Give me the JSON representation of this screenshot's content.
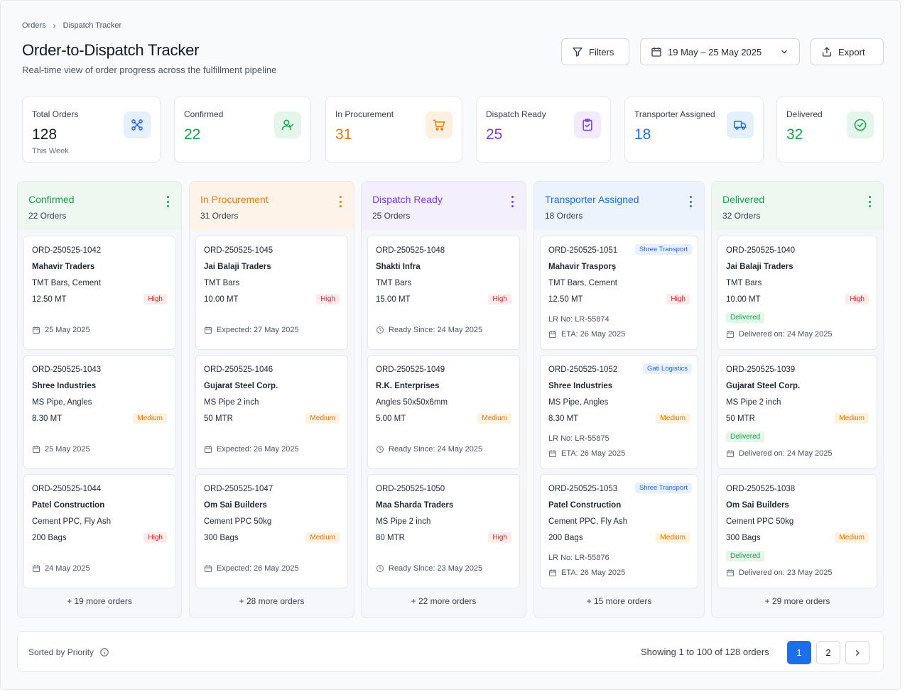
{
  "breadcrumb": {
    "root": "Orders",
    "current": "Dispatch Tracker"
  },
  "header": {
    "title": "Order-to-Dispatch Tracker",
    "subtitle": "Real-time view of order progress across the fulfillment pipeline",
    "filters_label": "Filters",
    "date_range": "19 May – 25 May 2025",
    "export_label": "Export"
  },
  "stats": [
    {
      "label": "Total Orders",
      "value": "128",
      "sub": "This Week",
      "icon": "network-icon",
      "color": "#111827",
      "tint": "#e6effc",
      "iconColor": "#2563eb"
    },
    {
      "label": "Confirmed",
      "value": "22",
      "icon": "user-check-icon",
      "color": "#16a34a",
      "tint": "#e6f5ec",
      "iconColor": "#16a34a"
    },
    {
      "label": "In Procurement",
      "value": "31",
      "icon": "cart-icon",
      "color": "#ea7a12",
      "tint": "#fdf0e1",
      "iconColor": "#ea7a12"
    },
    {
      "label": "Dispatch Ready",
      "value": "25",
      "icon": "clipboard-check-icon",
      "color": "#7c3aed",
      "tint": "#f1ebfd",
      "iconColor": "#7c3aed"
    },
    {
      "label": "Transporter Assigned",
      "value": "18",
      "icon": "truck-icon",
      "color": "#1d6fe8",
      "tint": "#e6effc",
      "iconColor": "#1d6fe8"
    },
    {
      "label": "Delivered",
      "value": "32",
      "icon": "check-circle-icon",
      "color": "#16a34a",
      "tint": "#e6f5ec",
      "iconColor": "#16a34a"
    }
  ],
  "columns": [
    {
      "name": "Confirmed",
      "count": "22 Orders",
      "more": "+ 19 more orders",
      "color": "#16a34a",
      "headerBg": "#eef8f1",
      "footIcon": "calendar-icon",
      "cards": [
        {
          "id": "ORD-250525-1042",
          "customer": "Mahavir Traders",
          "product": "TMT Bars, Cement",
          "qty": "12.50 MT",
          "priority": "High",
          "footer": "25 May 2025"
        },
        {
          "id": "ORD-250525-1043",
          "customer": "Shree Industries",
          "product": "MS Pipe, Angles",
          "qty": "8.30 MT",
          "priority": "Medium",
          "footer": "25 May 2025"
        },
        {
          "id": "ORD-250525-1044",
          "customer": "Patel Construction",
          "product": "Cement PPC, Fly Ash",
          "qty": "200 Bags",
          "priority": "High",
          "footer": "24 May 2025"
        }
      ]
    },
    {
      "name": "In Procurement",
      "count": "31 Orders",
      "more": "+ 28 more orders",
      "color": "#ea7a12",
      "headerBg": "#fdf3e8",
      "footIcon": "calendar-icon",
      "cards": [
        {
          "id": "ORD-250525-1045",
          "customer": "Jai Balaji Traders",
          "product": "TMT Bars",
          "qty": "10.00 MT",
          "priority": "High",
          "footer": "Expected: 27 May 2025"
        },
        {
          "id": "ORD-250525-1046",
          "customer": "Gujarat Steel Corp.",
          "product": "MS Pipe 2 inch",
          "qty": "50 MTR",
          "priority": "Medium",
          "footer": "Expected: 26 May 2025"
        },
        {
          "id": "ORD-250525-1047",
          "customer": "Om Sai Builders",
          "product": "Cement PPC 50kg",
          "qty": "300 Bags",
          "priority": "Medium",
          "footer": "Expected: 26 May 2025"
        }
      ]
    },
    {
      "name": "Dispatch Ready",
      "count": "25 Orders",
      "more": "+ 22 more orders",
      "color": "#7c3aed",
      "headerBg": "#f3effc",
      "footIcon": "clock-icon",
      "cards": [
        {
          "id": "ORD-250525-1048",
          "customer": "Shakti Infra",
          "product": "TMT Bars",
          "qty": "15.00 MT",
          "priority": "High",
          "footer": "Ready Since: 24 May 2025"
        },
        {
          "id": "ORD-250525-1049",
          "customer": "R.K. Enterprises",
          "product": "Angles 50x50x6mm",
          "qty": "5.00 MT",
          "priority": "Medium",
          "footer": "Ready Since: 24 May 2025"
        },
        {
          "id": "ORD-250525-1050",
          "customer": "Maa Sharda Traders",
          "product": "MS Pipe 2 inch",
          "qty": "80 MTR",
          "priority": "High",
          "footer": "Ready Since: 23 May 2025"
        }
      ]
    },
    {
      "name": "Transporter Assigned",
      "count": "18 Orders",
      "more": "+ 15 more orders",
      "color": "#1d6fe8",
      "headerBg": "#edf3fc",
      "footIcon": "calendar-icon",
      "cards": [
        {
          "id": "ORD-250525-1051",
          "customer": "Mahavir Trasporş",
          "product": "TMT Bars, Cement",
          "qty": "12.50 MT",
          "priority": "High",
          "carrier": "Shree Transport",
          "lr": "LR No: LR-55874",
          "footer": "ETA: 26 May 2025"
        },
        {
          "id": "ORD-250525-1052",
          "customer": "Shree Industries",
          "product": "MS Pipe, Angles",
          "qty": "8.30 MT",
          "priority": "Medium",
          "carrier": "Gati Logistics",
          "lr": "LR No: LR-55875",
          "footer": "ETA: 26 May 2025"
        },
        {
          "id": "ORD-250525-1053",
          "customer": "Patel Construction",
          "product": "Cement PPC, Fly Ash",
          "qty": "200 Bags",
          "priority": "Medium",
          "carrier": "Shree Transport",
          "lr": "LR No: LR-55876",
          "footer": "ETA: 26 May 2025"
        }
      ]
    },
    {
      "name": "Delivered",
      "count": "32 Orders",
      "more": "+ 29 more orders",
      "color": "#16a34a",
      "headerBg": "#eef8f1",
      "footIcon": "calendar-icon",
      "cards": [
        {
          "id": "ORD-250525-1040",
          "customer": "Jai Balaji Traders",
          "product": "TMT Bars",
          "qty": "10.00 MT",
          "priority": "High",
          "status": "Delivered",
          "footer": "Delivered on: 24 May 2025"
        },
        {
          "id": "ORD-250525-1039",
          "customer": "Gujarat Steel Corp.",
          "product": "MS Pipe 2 inch",
          "qty": "50 MTR",
          "priority": "Medium",
          "status": "Delivered",
          "footer": "Delivered on: 24 May 2025"
        },
        {
          "id": "ORD-250525-1038",
          "customer": "Om Sai Builders",
          "product": "Cement PPC 50kg",
          "qty": "300 Bags",
          "priority": "Medium",
          "status": "Delivered",
          "footer": "Delivered on: 23 May 2025"
        }
      ]
    }
  ],
  "footer": {
    "sort_label": "Sorted by Priority",
    "showing": "Showing 1 to 100 of 128 orders",
    "pages": [
      "1",
      "2"
    ]
  }
}
